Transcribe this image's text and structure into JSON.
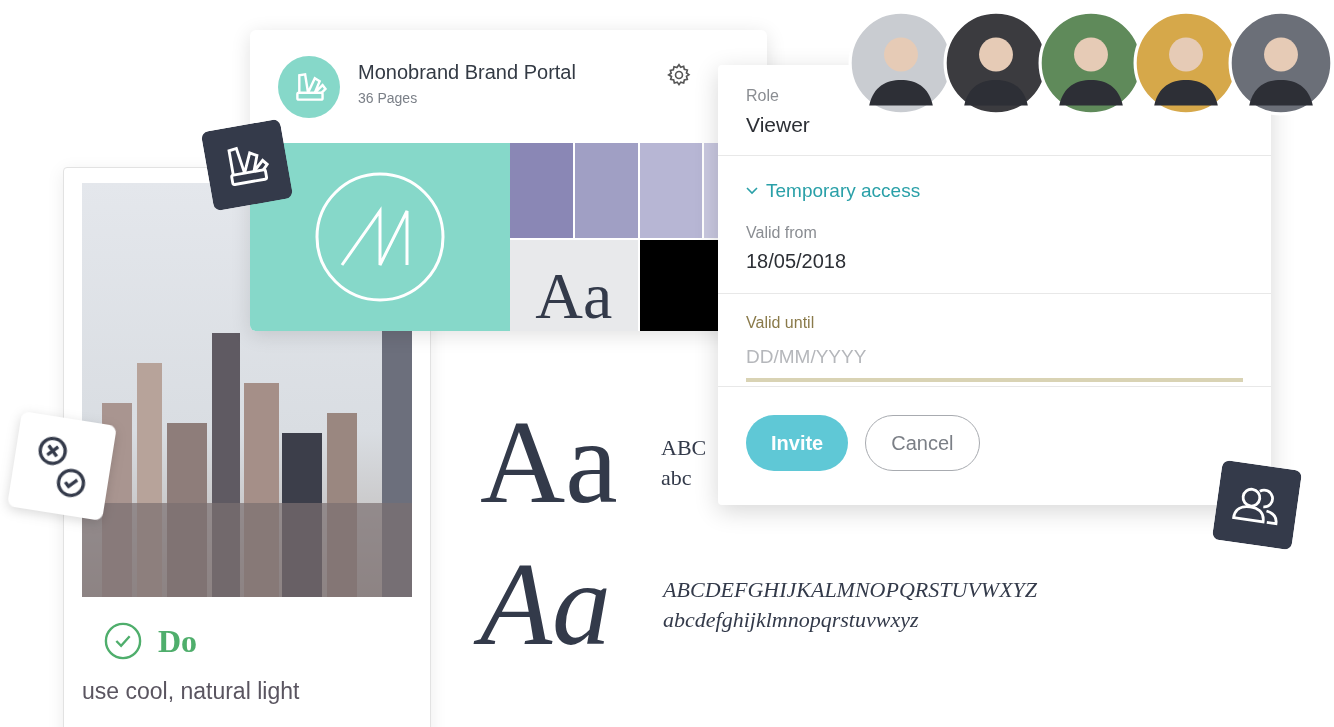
{
  "portal_card": {
    "title": "Monobrand Brand Portal",
    "subtitle": "36 Pages"
  },
  "palette_tiles": [
    {
      "kind": "swatch",
      "color": "#8a87b5"
    },
    {
      "kind": "swatch",
      "color": "#a09fc4"
    },
    {
      "kind": "swatch",
      "color": "#b7b6d4"
    },
    {
      "kind": "swatch",
      "color": "#c9c8e0"
    },
    {
      "kind": "type",
      "text": "Aa",
      "color": "#e8e9eb"
    },
    {
      "kind": "swatch",
      "color": "#000000"
    }
  ],
  "guideline_card": {
    "kind": "do",
    "status": "Do",
    "text": "use cool, natural light"
  },
  "type_specimen": {
    "regular": {
      "sample": "Aa",
      "upper": "ABC",
      "lower": "abc"
    },
    "italic": {
      "sample": "Aa",
      "upper": "ABCDEFGHIJKALMNOPQRSTUVWXYZ",
      "lower": "abcdefghijklmnopqrstuvwxyz"
    }
  },
  "invite_dialog": {
    "role_label": "Role",
    "role_value": "Viewer",
    "section": {
      "label": "Temporary access",
      "expanded": true
    },
    "valid_from": {
      "label": "Valid from",
      "value": "18/05/2018"
    },
    "valid_until": {
      "label": "Valid until",
      "placeholder": "DD/MM/YYYY",
      "focused": true
    },
    "buttons": [
      {
        "label": "Invite",
        "kind": "primary"
      },
      {
        "label": "Cancel",
        "kind": "secondary"
      }
    ]
  }
}
